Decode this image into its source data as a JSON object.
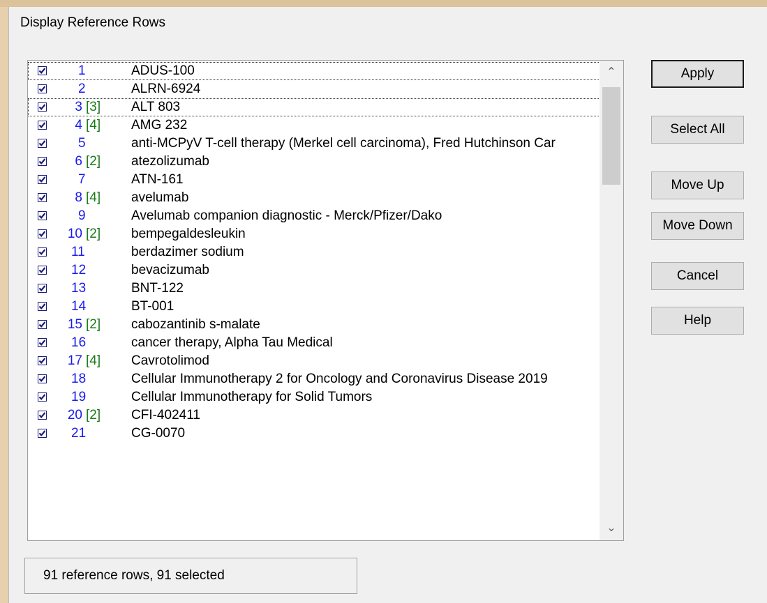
{
  "window": {
    "title": "Display Reference Rows"
  },
  "list": {
    "rows": [
      {
        "num": "1",
        "group": "",
        "name": "ADUS-100"
      },
      {
        "num": "2",
        "group": "",
        "name": "ALRN-6924"
      },
      {
        "num": "3",
        "group": "[3]",
        "name": "ALT 803"
      },
      {
        "num": "4",
        "group": "[4]",
        "name": "AMG 232"
      },
      {
        "num": "5",
        "group": "",
        "name": "anti-MCPyV T-cell therapy (Merkel cell carcinoma), Fred Hutchinson Car"
      },
      {
        "num": "6",
        "group": "[2]",
        "name": "atezolizumab"
      },
      {
        "num": "7",
        "group": "",
        "name": "ATN-161"
      },
      {
        "num": "8",
        "group": "[4]",
        "name": "avelumab"
      },
      {
        "num": "9",
        "group": "",
        "name": "Avelumab companion diagnostic - Merck/Pfizer/Dako"
      },
      {
        "num": "10",
        "group": "[2]",
        "name": "bempegaldesleukin"
      },
      {
        "num": "11",
        "group": "",
        "name": "berdazimer sodium"
      },
      {
        "num": "12",
        "group": "",
        "name": "bevacizumab"
      },
      {
        "num": "13",
        "group": "",
        "name": "BNT-122"
      },
      {
        "num": "14",
        "group": "",
        "name": "BT-001"
      },
      {
        "num": "15",
        "group": "[2]",
        "name": "cabozantinib s-malate"
      },
      {
        "num": "16",
        "group": "",
        "name": "cancer therapy, Alpha Tau Medical"
      },
      {
        "num": "17",
        "group": "[4]",
        "name": "Cavrotolimod"
      },
      {
        "num": "18",
        "group": "",
        "name": "Cellular Immunotherapy 2 for Oncology and Coronavirus Disease 2019"
      },
      {
        "num": "19",
        "group": "",
        "name": "Cellular Immunotherapy for Solid Tumors"
      },
      {
        "num": "20",
        "group": "[2]",
        "name": "CFI-402411"
      },
      {
        "num": "21",
        "group": "",
        "name": "CG-0070"
      }
    ]
  },
  "buttons": {
    "apply": "Apply",
    "select_all": "Select All",
    "move_up": "Move Up",
    "move_down": "Move Down",
    "cancel": "Cancel",
    "help": "Help"
  },
  "status": {
    "text": "91 reference rows,  91 selected"
  },
  "colors": {
    "number": "#1a1aee",
    "group": "#1a7a1a",
    "background": "#e6d0ad"
  }
}
